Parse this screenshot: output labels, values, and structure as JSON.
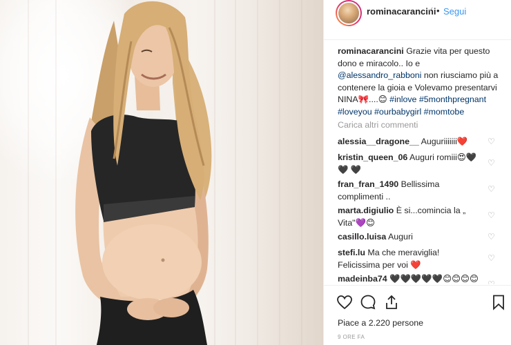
{
  "post": {
    "username": "rominacarancini",
    "verified_icon": "✓",
    "separator": "•",
    "follow_label": "Segui"
  },
  "caption": {
    "username": "rominacarancini",
    "text": "Grazie vita per questo dono e miracolo.. Io e ",
    "mention": "@alessandro_rabboni",
    "text2": " non riusciamo più a contenere la gioia e Volevamo presentarvi NINA🎀....😊 ",
    "hashtags": "#inlove #5monthpregnant #loveyou #ourbabygirl #momtobe"
  },
  "load_more": "Carica altri commenti",
  "comments": [
    {
      "user": "alessia__dragone__",
      "text": "Auguriiiiiii❤️"
    },
    {
      "user": "kristin_queen_06",
      "text": "Auguri romiii😍🖤🖤 🖤"
    },
    {
      "user": "fran_fran_1490",
      "text": "Bellissima complimenti .."
    },
    {
      "user": "marta.digiulio",
      "text": "È si...comincia la „ Vita\"💜😊"
    },
    {
      "user": "casillo.luisa",
      "text": "Auguri"
    },
    {
      "user": "stefi.lu",
      "text": "Ma che meraviglia! Felicissima per voi ❤️"
    },
    {
      "user": "madeinba74",
      "text": "🖤🖤🖤🖤🖤😊😊😊😊"
    }
  ],
  "likes": "Piace a 2.220 persone",
  "time": "9 ORE FA",
  "icons": {
    "like": "heart-icon",
    "comment": "comment-icon",
    "share": "share-icon",
    "save": "bookmark-icon"
  }
}
